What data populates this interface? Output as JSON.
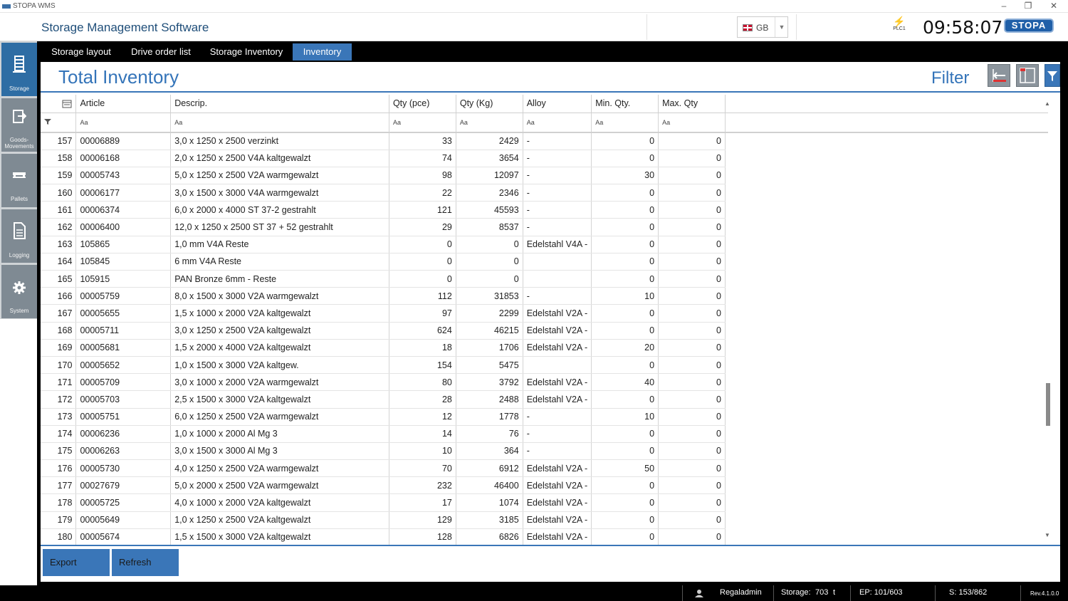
{
  "window": {
    "title": "STOPA WMS",
    "btn_min": "–",
    "btn_restore": "❐",
    "btn_close": "✕"
  },
  "header": {
    "app_title": "Storage Management Software",
    "language": "GB",
    "plc_label": "PLC1",
    "clock": "09:58:07",
    "logo": "STOPA"
  },
  "sidebar": [
    {
      "label": "Storage",
      "icon": "storage-icon"
    },
    {
      "label": "Goods-Movements",
      "icon": "goods-movements-icon"
    },
    {
      "label": "Pallets",
      "icon": "pallets-icon"
    },
    {
      "label": "Logging",
      "icon": "logging-icon"
    },
    {
      "label": "System",
      "icon": "gear-icon"
    }
  ],
  "tabs": [
    {
      "label": "Storage layout"
    },
    {
      "label": "Drive order list"
    },
    {
      "label": "Storage Inventory"
    },
    {
      "label": "Inventory"
    }
  ],
  "page": {
    "title": "Total Inventory",
    "filter_label": "Filter"
  },
  "grid": {
    "columns": [
      "Article",
      "Descrip.",
      "Qty (pce)",
      "Qty (Kg)",
      "Alloy",
      "Min. Qty.",
      "Max. Qty"
    ],
    "filter_glyph": "Aa",
    "rows": [
      [
        "157",
        "00006889",
        "3,0 x 1250 x 2500 verzinkt",
        "33",
        "2429",
        "-",
        "0",
        "0"
      ],
      [
        "158",
        "00006168",
        "2,0 x 1250 x 2500 V4A kaltgewalzt",
        "74",
        "3654",
        "-",
        "0",
        "0"
      ],
      [
        "159",
        "00005743",
        "5,0 x 1250 x 2500 V2A warmgewalzt",
        "98",
        "12097",
        "-",
        "30",
        "0"
      ],
      [
        "160",
        "00006177",
        "3,0 x 1500 x 3000 V4A warmgewalzt",
        "22",
        "2346",
        "-",
        "0",
        "0"
      ],
      [
        "161",
        "00006374",
        "6,0 x 2000 x 4000 ST 37-2 gestrahlt",
        "121",
        "45593",
        "-",
        "0",
        "0"
      ],
      [
        "162",
        "00006400",
        "12,0 x 1250 x 2500 ST 37 + 52 gestrahlt",
        "29",
        "8537",
        "-",
        "0",
        "0"
      ],
      [
        "163",
        "105865",
        "1,0 mm V4A Reste",
        "0",
        "0",
        "Edelstahl V4A -",
        "0",
        "0"
      ],
      [
        "164",
        "105845",
        "6 mm V4A Reste",
        "0",
        "0",
        "",
        "0",
        "0"
      ],
      [
        "165",
        "105915",
        "PAN Bronze 6mm - Reste",
        "0",
        "0",
        "",
        "0",
        "0"
      ],
      [
        "166",
        "00005759",
        "8,0 x 1500 x 3000 V2A warmgewalzt",
        "112",
        "31853",
        "-",
        "10",
        "0"
      ],
      [
        "167",
        "00005655",
        "1,5 x 1000 x 2000 V2A kaltgewalzt",
        "97",
        "2299",
        "Edelstahl V2A -",
        "0",
        "0"
      ],
      [
        "168",
        "00005711",
        "3,0 x 1250 x 2500 V2A kaltgewalzt",
        "624",
        "46215",
        "Edelstahl V2A -",
        "0",
        "0"
      ],
      [
        "169",
        "00005681",
        "1,5 x 2000 x 4000 V2A kaltgewalzt",
        "18",
        "1706",
        "Edelstahl V2A -",
        "20",
        "0"
      ],
      [
        "170",
        "00005652",
        "1,0 x 1500 x 3000 V2A kaltgew.",
        "154",
        "5475",
        "",
        "0",
        "0"
      ],
      [
        "171",
        "00005709",
        "3,0 x 1000 x 2000 V2A warmgewalzt",
        "80",
        "3792",
        "Edelstahl V2A -",
        "40",
        "0"
      ],
      [
        "172",
        "00005703",
        "2,5 x 1500 x 3000 V2A kaltgewalzt",
        "28",
        "2488",
        "Edelstahl V2A -",
        "0",
        "0"
      ],
      [
        "173",
        "00005751",
        "6,0 x 1250 x 2500 V2A warmgewalzt",
        "12",
        "1778",
        "-",
        "10",
        "0"
      ],
      [
        "174",
        "00006236",
        "1,0 x 1000 x 2000 Al Mg 3",
        "14",
        "76",
        "-",
        "0",
        "0"
      ],
      [
        "175",
        "00006263",
        "3,0 x 1500 x 3000 Al Mg 3",
        "10",
        "364",
        "-",
        "0",
        "0"
      ],
      [
        "176",
        "00005730",
        "4,0 x 1250 x 2500 V2A warmgewalzt",
        "70",
        "6912",
        "Edelstahl V2A -",
        "50",
        "0"
      ],
      [
        "177",
        "00027679",
        "5,0 x 2000 x 2500 V2A warmgewalzt",
        "232",
        "46400",
        "Edelstahl V2A -",
        "0",
        "0"
      ],
      [
        "178",
        "00005725",
        "4,0 x 1000 x 2000 V2A kaltgewalzt",
        "17",
        "1074",
        "Edelstahl V2A -",
        "0",
        "0"
      ],
      [
        "179",
        "00005649",
        "1,0 x 1250 x 2500 V2A kaltgewalzt",
        "129",
        "3185",
        "Edelstahl V2A -",
        "0",
        "0"
      ],
      [
        "180",
        "00005674",
        "1,5 x 1500 x 3000 V2A kaltgewalzt",
        "128",
        "6826",
        "Edelstahl V2A -",
        "0",
        "0"
      ]
    ]
  },
  "buttons": {
    "export": "Export",
    "refresh": "Refresh"
  },
  "status": {
    "user": "Regaladmin",
    "storage_label": "Storage:",
    "storage_value": "703",
    "storage_unit": "t",
    "ep": "EP: 101/603",
    "s": "S: 153/862",
    "rev": "Rev.4.1.0.0"
  },
  "colors": {
    "accent": "#3a76b8",
    "sidebar_active": "#2e6da4",
    "sidebar_item": "#7f8a93",
    "frame": "#000000"
  }
}
